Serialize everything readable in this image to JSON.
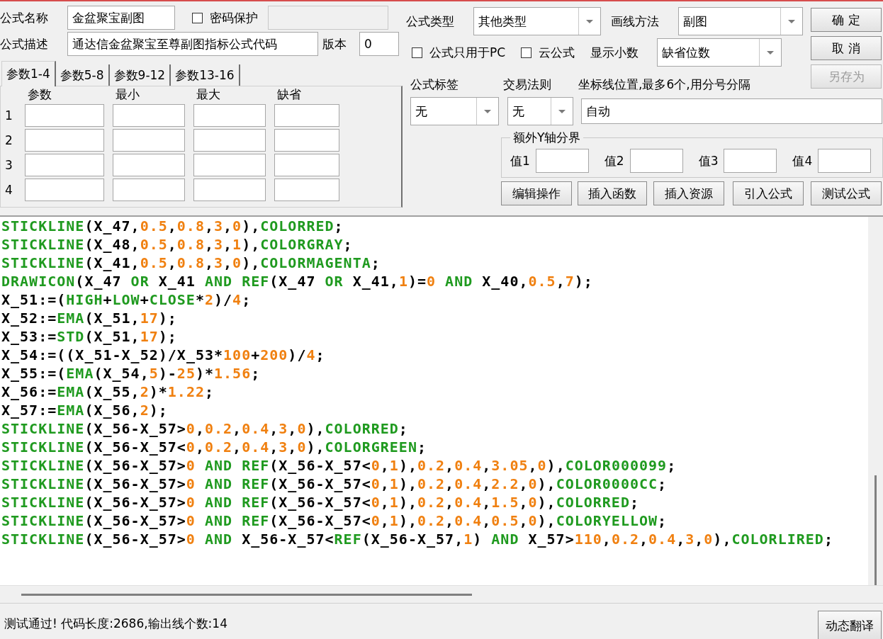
{
  "name_field": {
    "label": "公式名称",
    "value": "金盆聚宝副图"
  },
  "password": {
    "label": "密码保护",
    "checked": false
  },
  "password_field": {
    "disabled": true
  },
  "description_field": {
    "label": "公式描述",
    "value": "通达信金盆聚宝至尊副图指标公式代码"
  },
  "version_field": {
    "label": "版本",
    "value": "0"
  },
  "param_tabs": [
    {
      "label": "参数1-4",
      "selected": true
    },
    {
      "label": "参数5-8",
      "selected": false
    },
    {
      "label": "参数9-12",
      "selected": false
    },
    {
      "label": "参数13-16",
      "selected": false
    }
  ],
  "param_table": {
    "columns": [
      "参数",
      "最小",
      "最大",
      "缺省"
    ],
    "rows": [
      "1",
      "2",
      "3",
      "4"
    ]
  },
  "formula_type": {
    "label": "公式类型",
    "value": "其他类型"
  },
  "draw_method": {
    "label": "画线方法",
    "value": "副图"
  },
  "pc_only": {
    "label": "公式只用于PC",
    "checked": false
  },
  "cloud": {
    "label": "云公式",
    "checked": false
  },
  "decimals": {
    "label": "显示小数",
    "value": "缺省位数"
  },
  "formula_tag": {
    "label": "公式标签",
    "value": "无"
  },
  "trade_rule": {
    "label": "交易法则",
    "value": "无"
  },
  "axis_lines": {
    "label": "坐标线位置,最多6个,用分号分隔",
    "value": "自动"
  },
  "y_axis_bounds": {
    "title": "额外Y轴分界",
    "fields": [
      "值1",
      "值2",
      "值3",
      "值4"
    ]
  },
  "dialog_buttons": [
    {
      "label": "确 定",
      "disabled": false
    },
    {
      "label": "取 消",
      "disabled": false
    },
    {
      "label": "另存为",
      "disabled": true
    }
  ],
  "tool_buttons": [
    "编辑操作",
    "插入函数",
    "插入资源",
    "引入公式",
    "测试公式"
  ],
  "code_lines": [
    "STICKLINE(X_47,0.5,0.8,3,0),COLORRED;",
    "STICKLINE(X_48,0.5,0.8,3,1),COLORGRAY;",
    "STICKLINE(X_41,0.5,0.8,3,0),COLORMAGENTA;",
    "DRAWICON(X_47 OR X_41 AND REF(X_47 OR X_41,1)=0 AND X_40,0.5,7);",
    "X_51:=(HIGH+LOW+CLOSE*2)/4;",
    "X_52:=EMA(X_51,17);",
    "X_53:=STD(X_51,17);",
    "X_54:=((X_51-X_52)/X_53*100+200)/4;",
    "X_55:=(EMA(X_54,5)-25)*1.56;",
    "X_56:=EMA(X_55,2)*1.22;",
    "X_57:=EMA(X_56,2);",
    "STICKLINE(X_56-X_57>0,0.2,0.4,3,0),COLORRED;",
    "STICKLINE(X_56-X_57<0,0.2,0.4,3,0),COLORGREEN;",
    "STICKLINE(X_56-X_57>0 AND REF(X_56-X_57<0,1),0.2,0.4,3.05,0),COLOR000099;",
    "STICKLINE(X_56-X_57>0 AND REF(X_56-X_57<0,1),0.2,0.4,2.2,0),COLOR0000CC;",
    "STICKLINE(X_56-X_57>0 AND REF(X_56-X_57<0,1),0.2,0.4,1.5,0),COLORRED;",
    "STICKLINE(X_56-X_57>0 AND REF(X_56-X_57<0,1),0.2,0.4,0.5,0),COLORYELLOW;",
    "STICKLINE(X_56-X_57>0 AND X_56-X_57<REF(X_56-X_57,1) AND X_57>110,0.2,0.4,3,0),COLORLIRED;"
  ],
  "status_bar": {
    "message": "测试通过! 代码长度:2686,输出线个数:14",
    "button": "动态翻译"
  }
}
